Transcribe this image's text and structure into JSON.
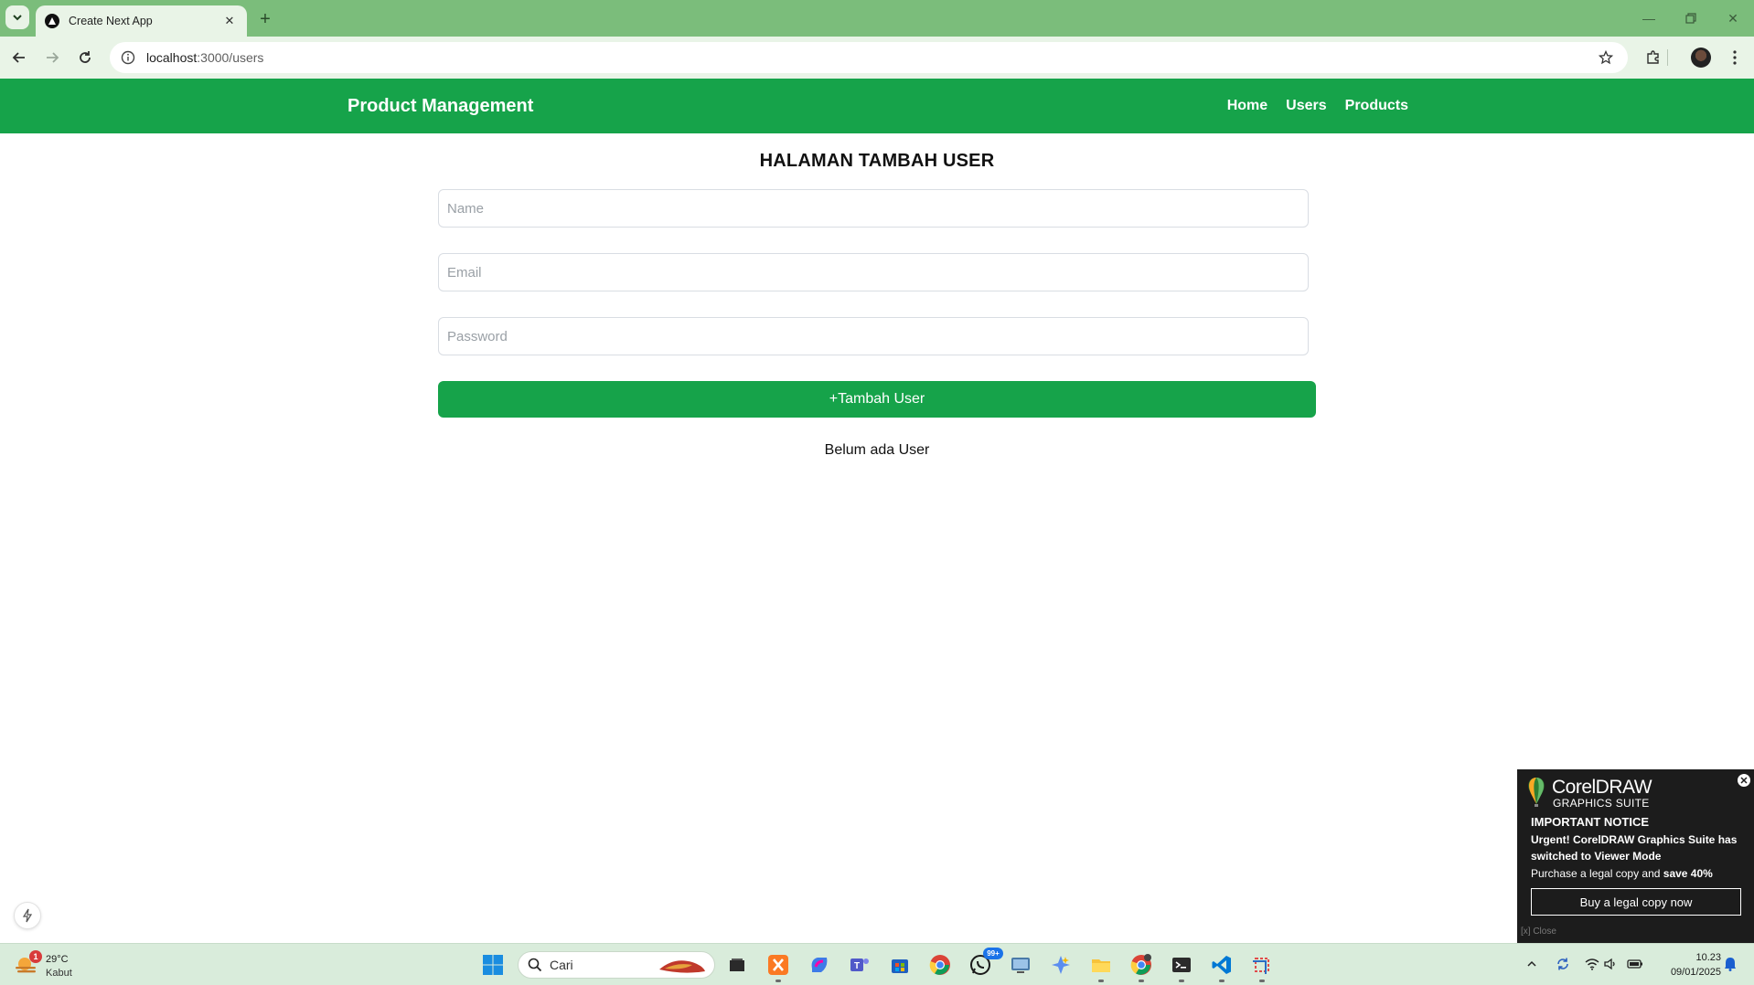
{
  "browser": {
    "tab_title": "Create Next App",
    "url_host": "localhost",
    "url_rest": ":3000/users"
  },
  "app": {
    "brand": "Product Management",
    "nav": [
      "Home",
      "Users",
      "Products"
    ],
    "page_title": "HALAMAN TAMBAH USER",
    "form": {
      "name_placeholder": "Name",
      "email_placeholder": "Email",
      "password_placeholder": "Password",
      "submit_label": "+Tambah User"
    },
    "empty_message": "Belum ada User"
  },
  "popup": {
    "brand": "CorelDRAW",
    "brand_sub": "GRAPHICS SUITE",
    "notice": "IMPORTANT NOTICE",
    "urgent": "Urgent! CorelDRAW Graphics Suite has switched to Viewer Mode",
    "purchase_prefix": "Purchase a legal copy and ",
    "purchase_bold": "save 40%",
    "buy_label": "Buy a legal copy now",
    "close_label": "[x] Close"
  },
  "taskbar": {
    "weather_temp": "29°C",
    "weather_cond": "Kabut",
    "weather_badge": "1",
    "search_text": "Cari",
    "whatsapp_badge": "99+",
    "time": "10.23",
    "date": "09/01/2025"
  },
  "colors": {
    "app_green": "#16a34a",
    "tabstrip_green": "#7bbd7b",
    "toolbar_bg": "#e9f4e7",
    "popup_bg": "#1c1c1c"
  }
}
